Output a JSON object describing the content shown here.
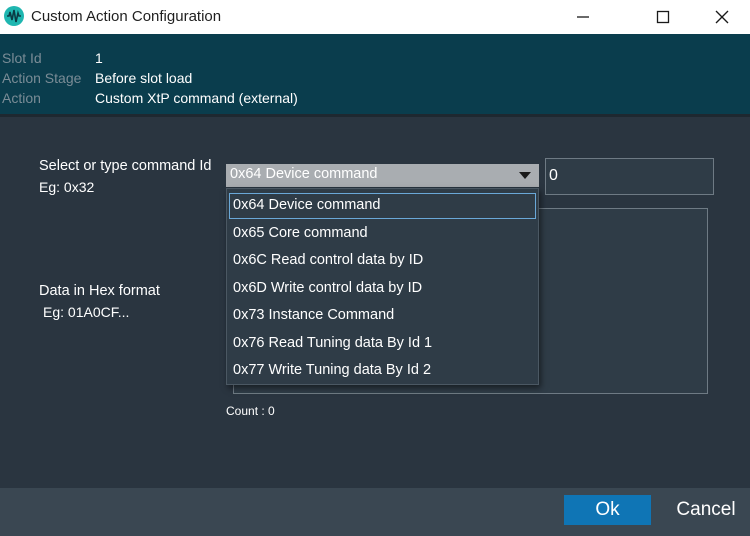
{
  "window": {
    "title": "Custom Action Configuration",
    "icon": "waveform-icon"
  },
  "info": {
    "rows": [
      {
        "label": "Slot Id",
        "value": "1"
      },
      {
        "label": "Action Stage",
        "value": "Before slot load"
      },
      {
        "label": "Action",
        "value": "Custom XtP command (external)"
      }
    ]
  },
  "form": {
    "command_label": "Select or type command Id",
    "command_hint": "Eg: 0x32",
    "command_selected": "0x64 Device command",
    "command_id_value": "0",
    "data_label": "Data in Hex format",
    "data_hint": "Eg: 01A0CF...",
    "data_value": "",
    "count_text": "Count : 0"
  },
  "dropdown": {
    "options": [
      "0x64 Device command",
      "0x65 Core command",
      "0x6C Read control data by ID",
      "0x6D Write control data by ID",
      "0x73 Instance Command",
      "0x76 Read Tuning data By Id 1",
      "0x77 Write Tuning data By Id 2"
    ],
    "selected_index": 0
  },
  "footer": {
    "ok_label": "Ok",
    "cancel_label": "Cancel"
  },
  "colors": {
    "info_bg": "#0a3d4d",
    "content_bg": "#2a3540",
    "footer_bg": "#3a4752",
    "accent": "#0f75b5",
    "app_icon": "#1fb6b0"
  }
}
